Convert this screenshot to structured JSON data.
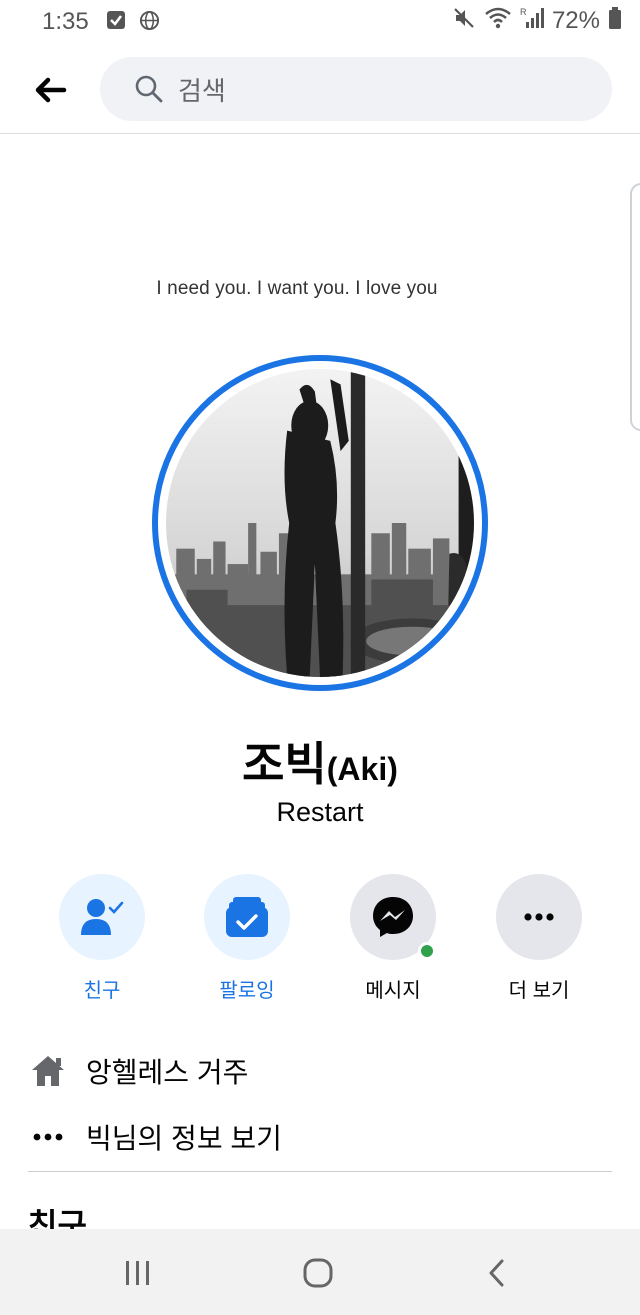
{
  "status_bar": {
    "time": "1:35",
    "battery": "72%",
    "icons": [
      "checkbox-icon",
      "globe-icon",
      "mute-icon",
      "wifi-icon",
      "signal-icon",
      "battery-icon"
    ]
  },
  "search": {
    "placeholder": "검색"
  },
  "cover": {
    "caption": "I need you. I want you. I love you"
  },
  "profile": {
    "name": "조빅",
    "alt_name": "(Aki)",
    "bio": "Restart"
  },
  "actions": [
    {
      "label": "친구",
      "icon": "friend-check-icon"
    },
    {
      "label": "팔로잉",
      "icon": "following-icon"
    },
    {
      "label": "메시지",
      "icon": "messenger-icon"
    },
    {
      "label": "더 보기",
      "icon": "more-icon"
    }
  ],
  "info": {
    "location": "앙헬레스 거주",
    "see_about": "빅님의 정보 보기"
  },
  "friends_section": {
    "title": "친구"
  },
  "colors": {
    "accent": "#1b74e4",
    "online": "#31a24c"
  }
}
